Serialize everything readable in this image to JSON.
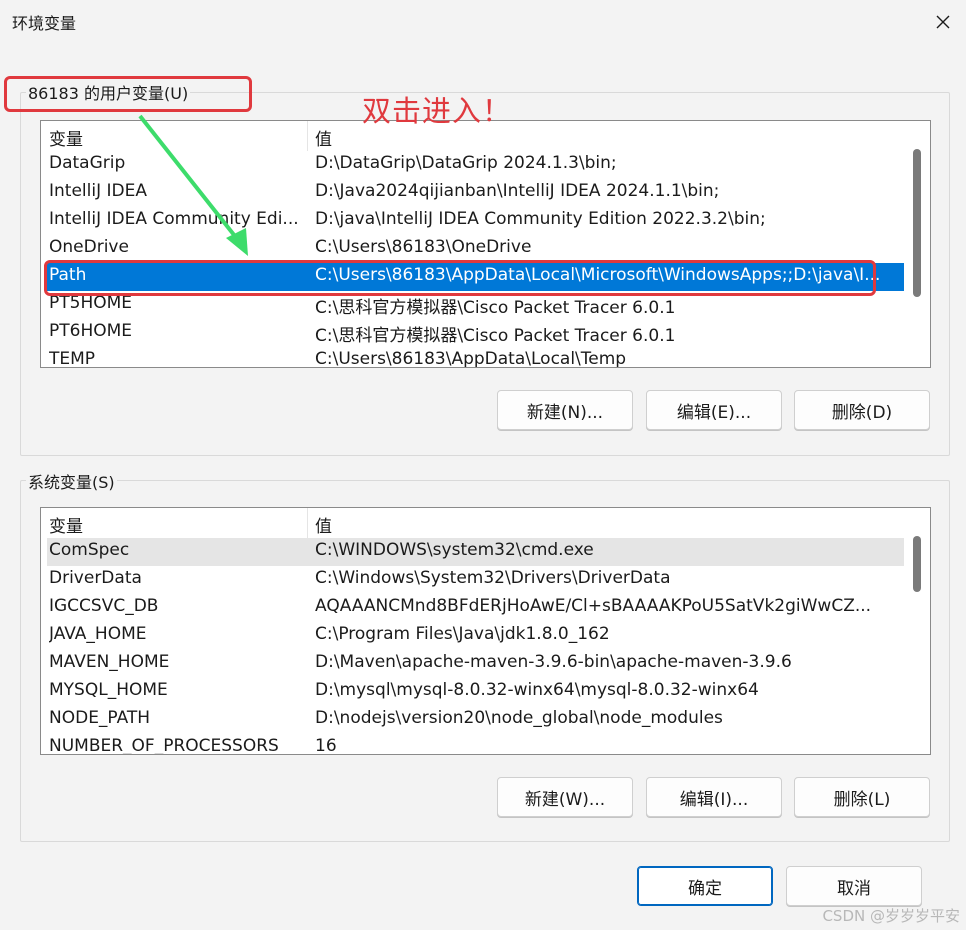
{
  "window": {
    "title": "环境变量"
  },
  "user_vars": {
    "label": "86183 的用户变量(U)",
    "col_var": "变量",
    "col_val": "值",
    "rows": [
      {
        "name": "DataGrip",
        "value": "D:\\DataGrip\\DataGrip 2024.1.3\\bin;"
      },
      {
        "name": "IntelliJ IDEA",
        "value": "D:\\Java2024qijianban\\IntelliJ IDEA 2024.1.1\\bin;"
      },
      {
        "name": "IntelliJ IDEA Community Edi...",
        "value": "D:\\java\\IntelliJ IDEA Community Edition 2022.3.2\\bin;"
      },
      {
        "name": "OneDrive",
        "value": "C:\\Users\\86183\\OneDrive"
      },
      {
        "name": "Path",
        "value": "C:\\Users\\86183\\AppData\\Local\\Microsoft\\WindowsApps;;D:\\java\\I..."
      },
      {
        "name": "PT5HOME",
        "value": "C:\\思科官方模拟器\\Cisco Packet Tracer 6.0.1"
      },
      {
        "name": "PT6HOME",
        "value": "C:\\思科官方模拟器\\Cisco Packet Tracer 6.0.1"
      },
      {
        "name": "TEMP",
        "value": "C:\\Users\\86183\\AppData\\Local\\Temp"
      }
    ],
    "new_label": "新建(N)...",
    "edit_label": "编辑(E)...",
    "delete_label": "删除(D)"
  },
  "system_vars": {
    "label": "系统变量(S)",
    "col_var": "变量",
    "col_val": "值",
    "rows": [
      {
        "name": "ComSpec",
        "value": "C:\\WINDOWS\\system32\\cmd.exe"
      },
      {
        "name": "DriverData",
        "value": "C:\\Windows\\System32\\Drivers\\DriverData"
      },
      {
        "name": "IGCCSVC_DB",
        "value": "AQAAANCMnd8BFdERjHoAwE/Cl+sBAAAAKPoU5SatVk2giWwCZ..."
      },
      {
        "name": "JAVA_HOME",
        "value": "C:\\Program Files\\Java\\jdk1.8.0_162"
      },
      {
        "name": "MAVEN_HOME",
        "value": "D:\\Maven\\apache-maven-3.9.6-bin\\apache-maven-3.9.6"
      },
      {
        "name": "MYSQL_HOME",
        "value": "D:\\mysql\\mysql-8.0.32-winx64\\mysql-8.0.32-winx64"
      },
      {
        "name": "NODE_PATH",
        "value": "D:\\nodejs\\version20\\node_global\\node_modules"
      },
      {
        "name": "NUMBER_OF_PROCESSORS",
        "value": "16"
      }
    ],
    "new_label": "新建(W)...",
    "edit_label": "编辑(I)...",
    "delete_label": "删除(L)"
  },
  "footer": {
    "ok_label": "确定",
    "cancel_label": "取消"
  },
  "annotation": {
    "text": "双击进入！",
    "color": "#e0393e",
    "arrow_color": "#3ddc6b"
  },
  "watermark": "CSDN @岁岁岁平安",
  "colors": {
    "selection": "#0078d7",
    "accent": "#0067c0"
  }
}
